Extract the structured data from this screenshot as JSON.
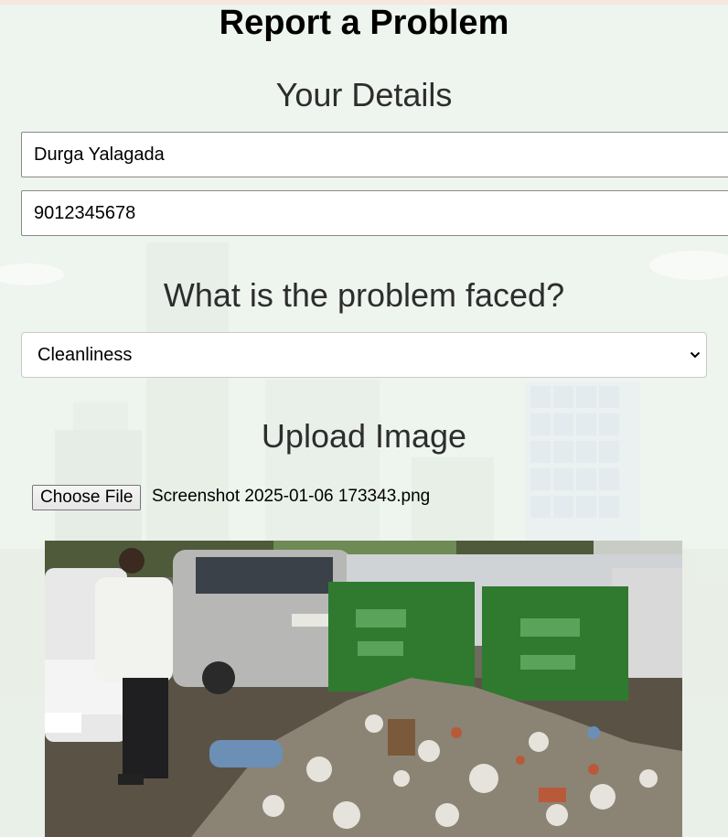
{
  "page": {
    "title": "Report a Problem"
  },
  "details": {
    "heading": "Your Details",
    "name_value": "Durga Yalagada",
    "phone_value": "9012345678"
  },
  "problem": {
    "heading": "What is the problem faced?",
    "selected_option": "Cleanliness"
  },
  "upload": {
    "heading": "Upload Image",
    "choose_file_label": "Choose File",
    "file_name": "Screenshot 2025-01-06 173343.png"
  },
  "preview": {
    "description_icon": "garbage-dump-photo"
  },
  "colors": {
    "background": "#eef4ee",
    "bin_green": "#2f7a2f"
  }
}
